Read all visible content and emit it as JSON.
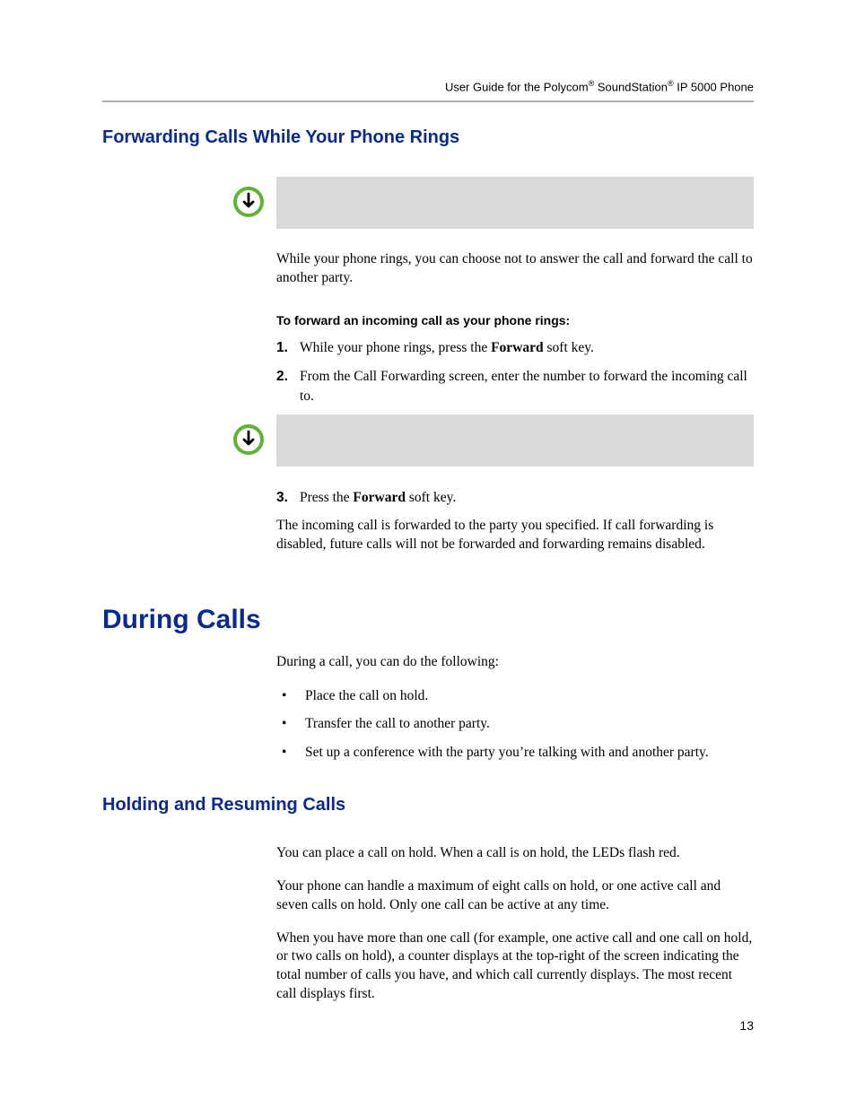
{
  "header": {
    "text_html": "User Guide for the Polycom<sup>®</sup> SoundStation<sup>®</sup> IP 5000 Phone"
  },
  "section1": {
    "heading": "Forwarding Calls While Your Phone Rings",
    "intro": "While your phone rings, you can choose not to answer the call and forward the call to another party.",
    "subheading": "To forward an incoming call as your phone rings:",
    "steps_a": [
      {
        "n": "1.",
        "html": "While your phone rings, press the <strong>Forward</strong> soft key."
      },
      {
        "n": "2.",
        "html": "From the Call Forwarding screen, enter the number to forward the incoming call to."
      }
    ],
    "steps_b": [
      {
        "n": "3.",
        "html": "Press the <strong>Forward</strong> soft key."
      }
    ],
    "result": "The incoming call is forwarded to the party you specified. If call forwarding is disabled, future calls will not be forwarded and forwarding remains disabled."
  },
  "section2": {
    "heading": "During Calls",
    "intro": "During a call, you can do the following:",
    "bullets": [
      "Place the call on hold.",
      "Transfer the call to another party.",
      "Set up a conference with the party you’re talking with and another party."
    ]
  },
  "section3": {
    "heading": "Holding and Resuming Calls",
    "paras": [
      "You can place a call on hold. When a call is on hold, the LEDs flash red.",
      "Your phone can handle a maximum of eight calls on hold, or one active call and seven calls on hold. Only one call can be active at any time.",
      "When you have more than one call (for example, one active call and one call on hold, or two calls on hold), a counter displays at the top-right of the screen indicating the total number of calls you have, and which call currently displays. The most recent call displays first."
    ]
  },
  "page_number": "13"
}
